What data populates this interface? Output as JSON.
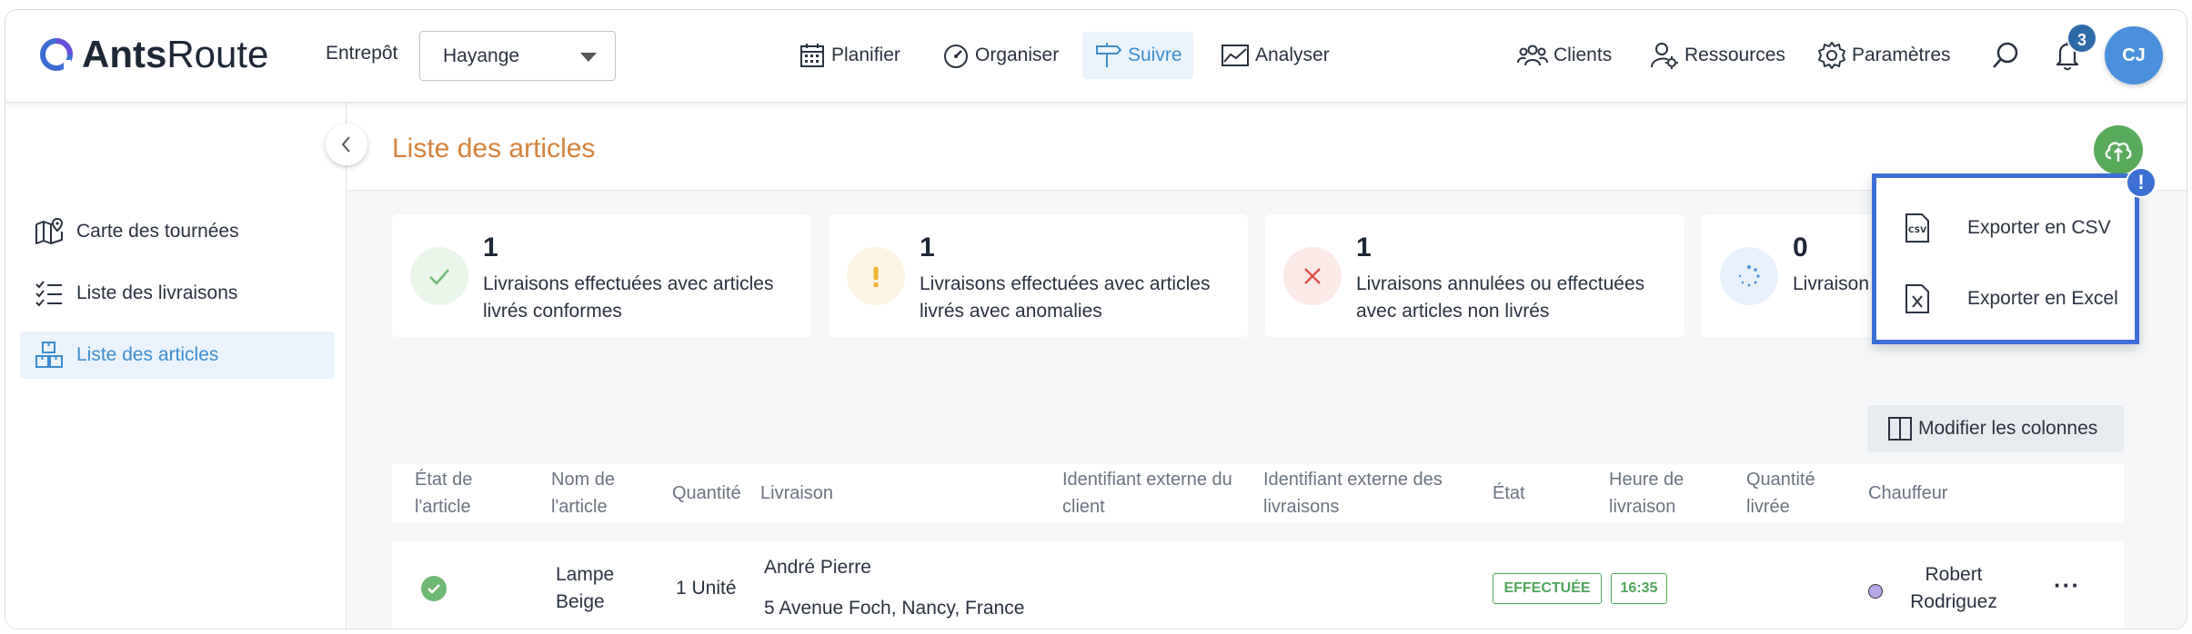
{
  "app": {
    "brand_bold": "Ants",
    "brand_light": "Route"
  },
  "header": {
    "warehouse_label": "Entrepôt",
    "warehouse_value": "Hayange",
    "nav": [
      "Planifier",
      "Organiser",
      "Suivre",
      "Analyser"
    ],
    "right_nav": [
      "Clients",
      "Ressources",
      "Paramètres"
    ],
    "notif_count": "3",
    "avatar_initials": "CJ"
  },
  "sidebar": {
    "items": [
      {
        "label": "Carte des tournées",
        "icon": "map-icon"
      },
      {
        "label": "Liste des livraisons",
        "icon": "checklist-icon"
      },
      {
        "label": "Liste des articles",
        "icon": "boxes-icon",
        "active": true
      }
    ]
  },
  "main": {
    "title": "Liste des articles",
    "cards": [
      {
        "count": "1",
        "desc": "Livraisons effectuées avec articles livrés conformes",
        "icon": "check-icon",
        "color": "#5aaa5c"
      },
      {
        "count": "1",
        "desc": "Livraisons effectuées avec articles livrés avec anomalies",
        "icon": "exclamation-icon",
        "color": "#f2b233"
      },
      {
        "count": "1",
        "desc": "Livraisons annulées ou effectuées avec articles non livrés",
        "icon": "close-icon",
        "color": "#e0514a"
      },
      {
        "count": "0",
        "desc": "Livraison",
        "icon": "spinner-icon",
        "color": "#4a90dc"
      }
    ],
    "columns_button": "Modifier les colonnes",
    "table": {
      "headers": [
        "État de l'article",
        "Nom de l'article",
        "Quantité",
        "Livraison",
        "Identifiant externe du client",
        "Identifiant externe des livraisons",
        "État",
        "Heure de livraison",
        "Quantité livrée",
        "Chauffeur"
      ],
      "rows": [
        {
          "article": "Lampe Beige",
          "quantity": "1 Unité",
          "delivery_name": "André Pierre",
          "delivery_address": "5 Avenue Foch, Nancy, France",
          "status": "EFFECTUÉE",
          "time": "16:35",
          "driver": "Robert Rodriguez",
          "driver_color": "#b7a6e8"
        }
      ]
    }
  },
  "export_menu": {
    "items": [
      "Exporter en CSV",
      "Exporter en Excel"
    ],
    "alert": "!"
  }
}
